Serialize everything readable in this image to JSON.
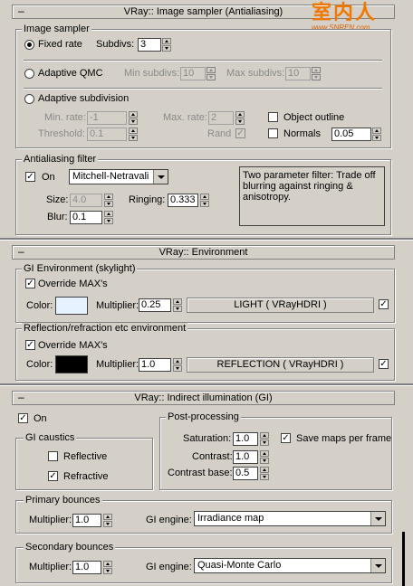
{
  "watermark": {
    "cn": "室内人",
    "url": "www.SNREN.com"
  },
  "image_sampler": {
    "title": "VRay:: Image sampler (Antialiasing)",
    "group": "Image sampler",
    "fixed_rate": "Fixed rate",
    "subdivs_label": "Subdivs:",
    "subdivs": "3",
    "adaptive_qmc": "Adaptive QMC",
    "min_subdivs_label": "Min subdivs:",
    "min_subdivs": "10",
    "max_subdivs_label": "Max subdivs:",
    "max_subdivs": "10",
    "adaptive_subdivision": "Adaptive subdivision",
    "min_rate_label": "Min. rate:",
    "min_rate": "-1",
    "max_rate_label": "Max. rate:",
    "max_rate": "2",
    "object_outline": "Object outline",
    "threshold_label": "Threshold:",
    "threshold": "0.1",
    "rand": "Rand",
    "normals": "Normals",
    "normals_value": "0.05"
  },
  "aa_filter": {
    "group": "Antialiasing filter",
    "on": "On",
    "filter": "Mitchell-Netravali",
    "size_label": "Size:",
    "size": "4.0",
    "ringing_label": "Ringing:",
    "ringing": "0.333",
    "blur_label": "Blur:",
    "blur": "0.1",
    "description": "Two parameter filter: Trade off blurring against ringing & anisotropy."
  },
  "environment": {
    "title": "VRay:: Environment",
    "gi_group": "GI Environment (skylight)",
    "override": "Override MAX's",
    "color_label": "Color:",
    "multiplier_label": "Multiplier:",
    "gi_multiplier": "0.25",
    "gi_map": "LIGHT  ( VRayHDRI )",
    "gi_color": "#e6f2ff",
    "refl_group": "Reflection/refraction etc environment",
    "refl_multiplier": "1.0",
    "refl_map": "REFLECTION  ( VRayHDRI )",
    "refl_color": "#000000"
  },
  "gi": {
    "title": "VRay:: Indirect illumination (GI)",
    "on": "On",
    "caustics_group": "GI caustics",
    "reflective": "Reflective",
    "refractive": "Refractive",
    "post_group": "Post-processing",
    "saturation_label": "Saturation:",
    "saturation": "1.0",
    "contrast_label": "Contrast:",
    "contrast": "1.0",
    "contrast_base_label": "Contrast base:",
    "contrast_base": "0.5",
    "save_maps": "Save maps per frame",
    "primary_group": "Primary bounces",
    "multiplier_label": "Multiplier:",
    "primary_multiplier": "1.0",
    "engine_label": "GI engine:",
    "primary_engine": "Irradiance map",
    "secondary_group": "Secondary bounces",
    "secondary_multiplier": "1.0",
    "secondary_engine": "Quasi-Monte Carlo"
  }
}
